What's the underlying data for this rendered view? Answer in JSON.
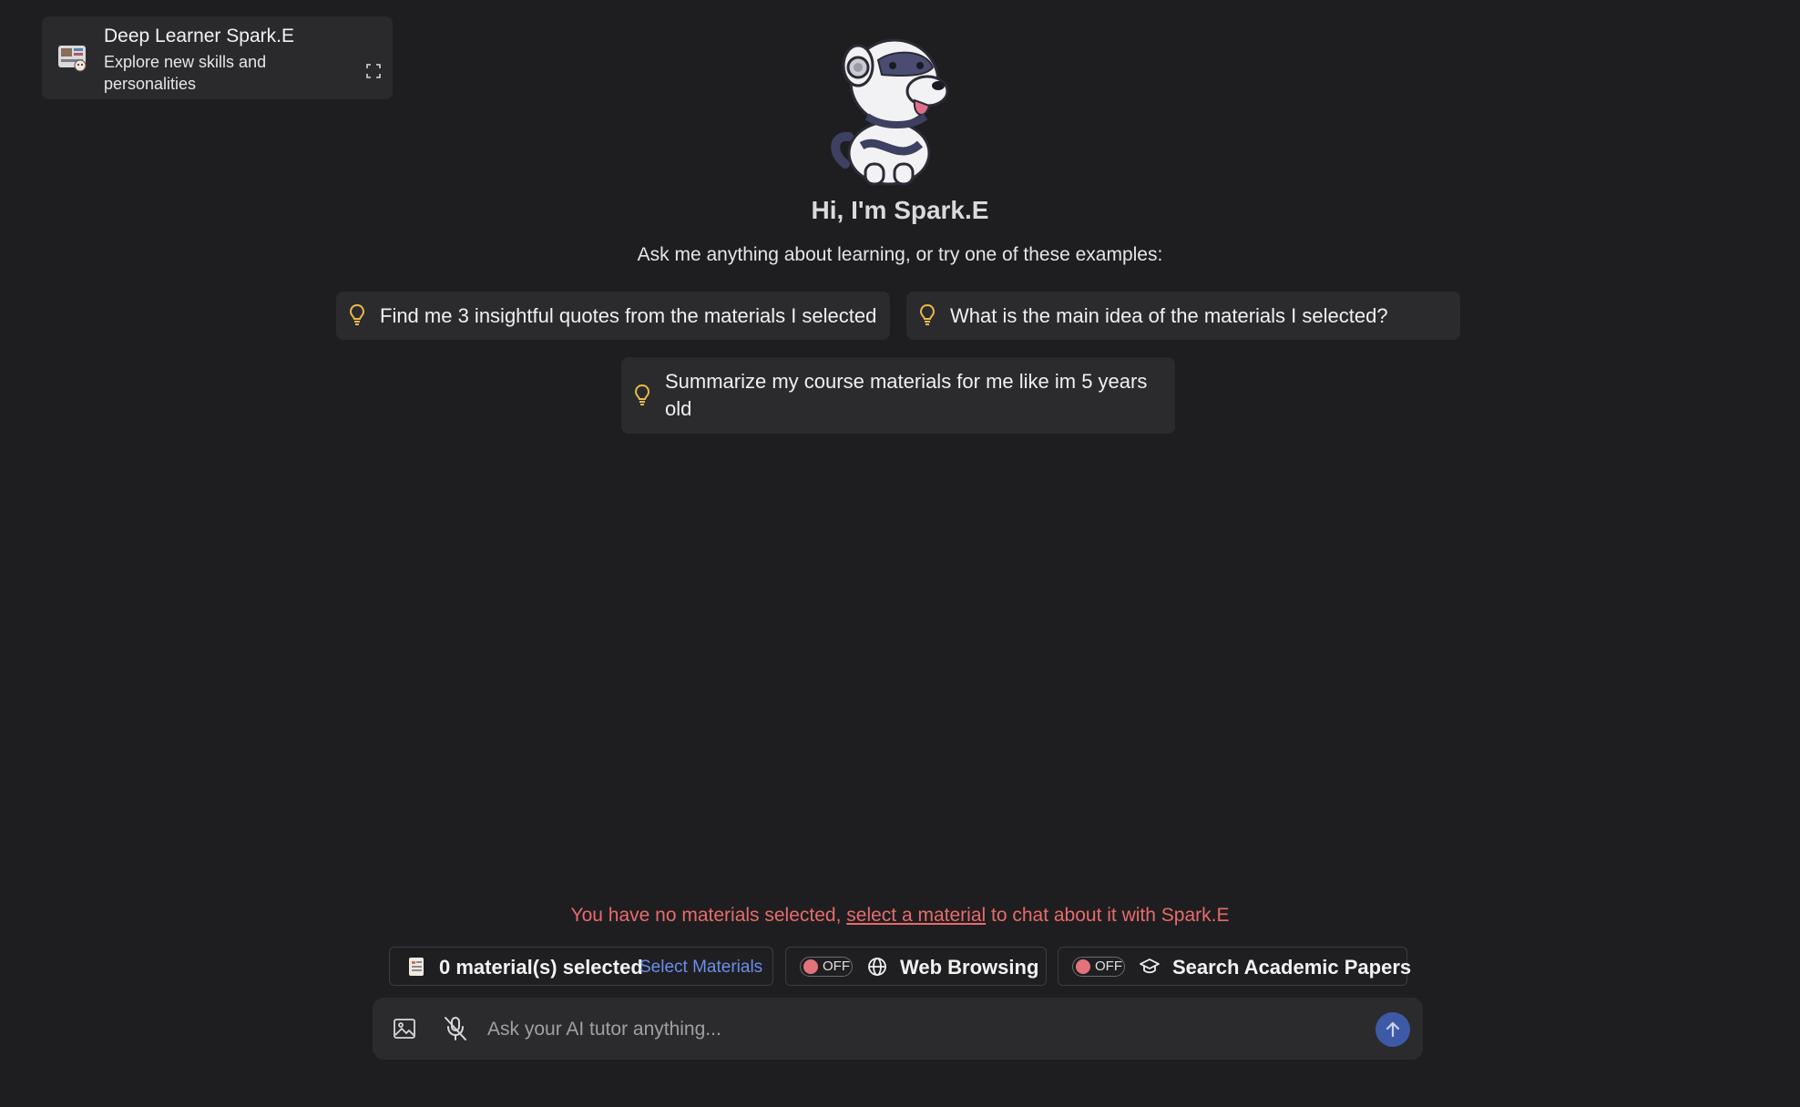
{
  "persona": {
    "title": "Deep Learner Spark.E",
    "subtitle": "Explore new skills and personalities"
  },
  "greeting": {
    "title": "Hi, I'm Spark.E",
    "subtitle": "Ask me anything about learning, or try one of these examples:"
  },
  "examples": [
    "Find me 3 insightful quotes from the materials I selected",
    "What is the main idea of the materials I selected?",
    "Summarize my course materials for me like im 5 years old"
  ],
  "warning": {
    "before": "You have no materials selected, ",
    "link": "select a material",
    "after": " to chat about it with Spark.E"
  },
  "toolbar": {
    "materials_count": "0 material(s) selected",
    "select_materials": "Select Materials",
    "web_browsing": {
      "state": "OFF",
      "label": "Web Browsing"
    },
    "academic_papers": {
      "state": "OFF",
      "label": "Search Academic Papers"
    }
  },
  "input": {
    "placeholder": "Ask your AI tutor anything..."
  },
  "colors": {
    "background": "#1e1e20",
    "card": "#2b2b2e",
    "warning": "#e86b6b",
    "link_blue": "#6c8eea",
    "toggle_off": "#e2737a",
    "send_button": "#3e5aa6",
    "bulb": "#e8b84a"
  },
  "icons": {
    "persona": "persona-avatar-icon",
    "expand": "expand-icon",
    "bulb": "lightbulb-icon",
    "document": "document-icon",
    "globe": "globe-icon",
    "graduation_cap": "graduation-cap-icon",
    "image": "image-icon",
    "mic_off": "mic-off-icon",
    "send": "arrow-up-icon"
  }
}
